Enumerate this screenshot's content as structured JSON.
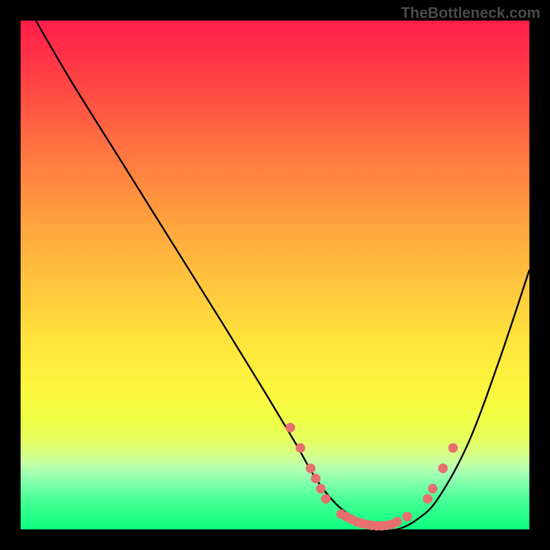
{
  "watermark": "TheBottleneck.com",
  "chart_data": {
    "type": "line",
    "title": "",
    "xlabel": "",
    "ylabel": "",
    "xlim": [
      0,
      100
    ],
    "ylim": [
      0,
      100
    ],
    "series": [
      {
        "name": "bottleneck-curve",
        "x": [
          3,
          10,
          20,
          30,
          40,
          48,
          54,
          58,
          62,
          66,
          70,
          74,
          78,
          82,
          88,
          94,
          100
        ],
        "y": [
          100,
          88,
          72,
          56,
          40,
          27,
          17,
          10,
          5,
          2,
          0,
          0,
          2,
          6,
          17,
          33,
          51
        ]
      }
    ],
    "markers": {
      "name": "highlight-points",
      "color": "#e76f6f",
      "points": [
        {
          "x": 53,
          "y": 20
        },
        {
          "x": 55,
          "y": 16
        },
        {
          "x": 57,
          "y": 12
        },
        {
          "x": 58,
          "y": 10
        },
        {
          "x": 59,
          "y": 8
        },
        {
          "x": 60,
          "y": 6
        },
        {
          "x": 63,
          "y": 3
        },
        {
          "x": 64,
          "y": 2.5
        },
        {
          "x": 65,
          "y": 2
        },
        {
          "x": 66,
          "y": 1.5
        },
        {
          "x": 67,
          "y": 1.2
        },
        {
          "x": 68,
          "y": 1
        },
        {
          "x": 69,
          "y": 0.8
        },
        {
          "x": 70,
          "y": 0.7
        },
        {
          "x": 71,
          "y": 0.7
        },
        {
          "x": 72,
          "y": 0.8
        },
        {
          "x": 73,
          "y": 1
        },
        {
          "x": 74,
          "y": 1.5
        },
        {
          "x": 76,
          "y": 2.5
        },
        {
          "x": 80,
          "y": 6
        },
        {
          "x": 81,
          "y": 8
        },
        {
          "x": 83,
          "y": 12
        },
        {
          "x": 85,
          "y": 16
        }
      ]
    }
  }
}
